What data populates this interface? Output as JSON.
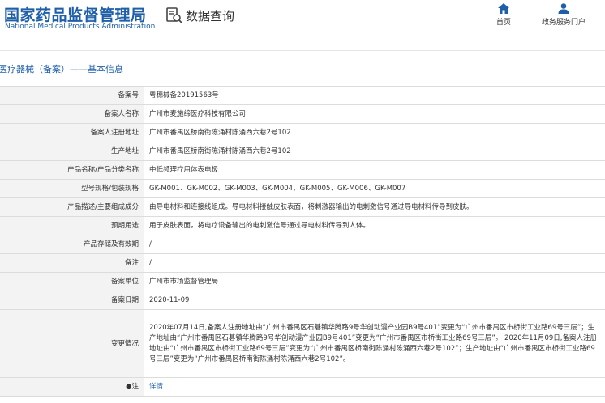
{
  "header": {
    "brand_cn": "国家药品监督管理局",
    "brand_en": "National Medical Products Administration",
    "section_title": "数据查询",
    "nav": [
      {
        "label": "首页",
        "icon": "home-icon"
      },
      {
        "label": "政务服务门户",
        "icon": "user-icon"
      }
    ]
  },
  "breadcrumb": "医疗器械（备案）——基本信息",
  "table": {
    "rows": [
      {
        "label": "备案号",
        "value": "粤穗械备20191563号"
      },
      {
        "label": "备案人名称",
        "value": "广州市麦施缔医疗科技有限公司"
      },
      {
        "label": "备案人注册地址",
        "value": "广州市番禺区桥南街陈涌村陈涌西六巷2号102"
      },
      {
        "label": "生产地址",
        "value": "广州市番禺区桥南街陈涌村陈涌西六巷2号102"
      },
      {
        "label": "产品名称/产品分类名称",
        "value": "中低频理疗用体表电极"
      },
      {
        "label": "型号规格/包装规格",
        "value": "GK-M001、GK-M002、GK-M003、GK-M004、GK-M005、GK-M006、GK-M007"
      },
      {
        "label": "产品描述/主要组成成分",
        "value": "由导电材料和连接线组成。导电材料接触皮肤表面，将刺激器输出的电刺激信号通过导电材料传导到皮肤。"
      },
      {
        "label": "预期用途",
        "value": "用于皮肤表面，将电疗设备输出的电刺激信号通过导电材料传导到人体。"
      },
      {
        "label": "产品存储及有效期",
        "value": "/"
      },
      {
        "label": "备注",
        "value": "/"
      },
      {
        "label": "备案单位",
        "value": "广州市市场监督管理局"
      },
      {
        "label": "备案日期",
        "value": "2020-11-09"
      },
      {
        "label": "变更情况",
        "value": "2020年07月14日,备案人注册地址由“广州市番禺区石碁镇华腾路9号华创动漫产业园B9号401”变更为“广州市番禺区市桥街工业路69号三层”；生产地址由“广州市番禺区石碁镇华腾路9号华创动漫产业园B9号401”变更为“广州市番禺区市桥街工业路69号三层”。 2020年11月09日,备案人注册地址由“广州市番禺区市桥街工业路69号三层”变更为“广州市番禺区桥南街陈涌村陈涌西六巷2号102”；生产地址由“广州市番禺区市桥街工业路69号三层”变更为“广州市番禺区桥南街陈涌村陈涌西六巷2号102”。"
      },
      {
        "label": "注",
        "value": "详情"
      }
    ]
  },
  "colors": {
    "brand": "#1f5fa8",
    "label_bg": "#f3f3f3",
    "border": "#dcdcdc"
  }
}
